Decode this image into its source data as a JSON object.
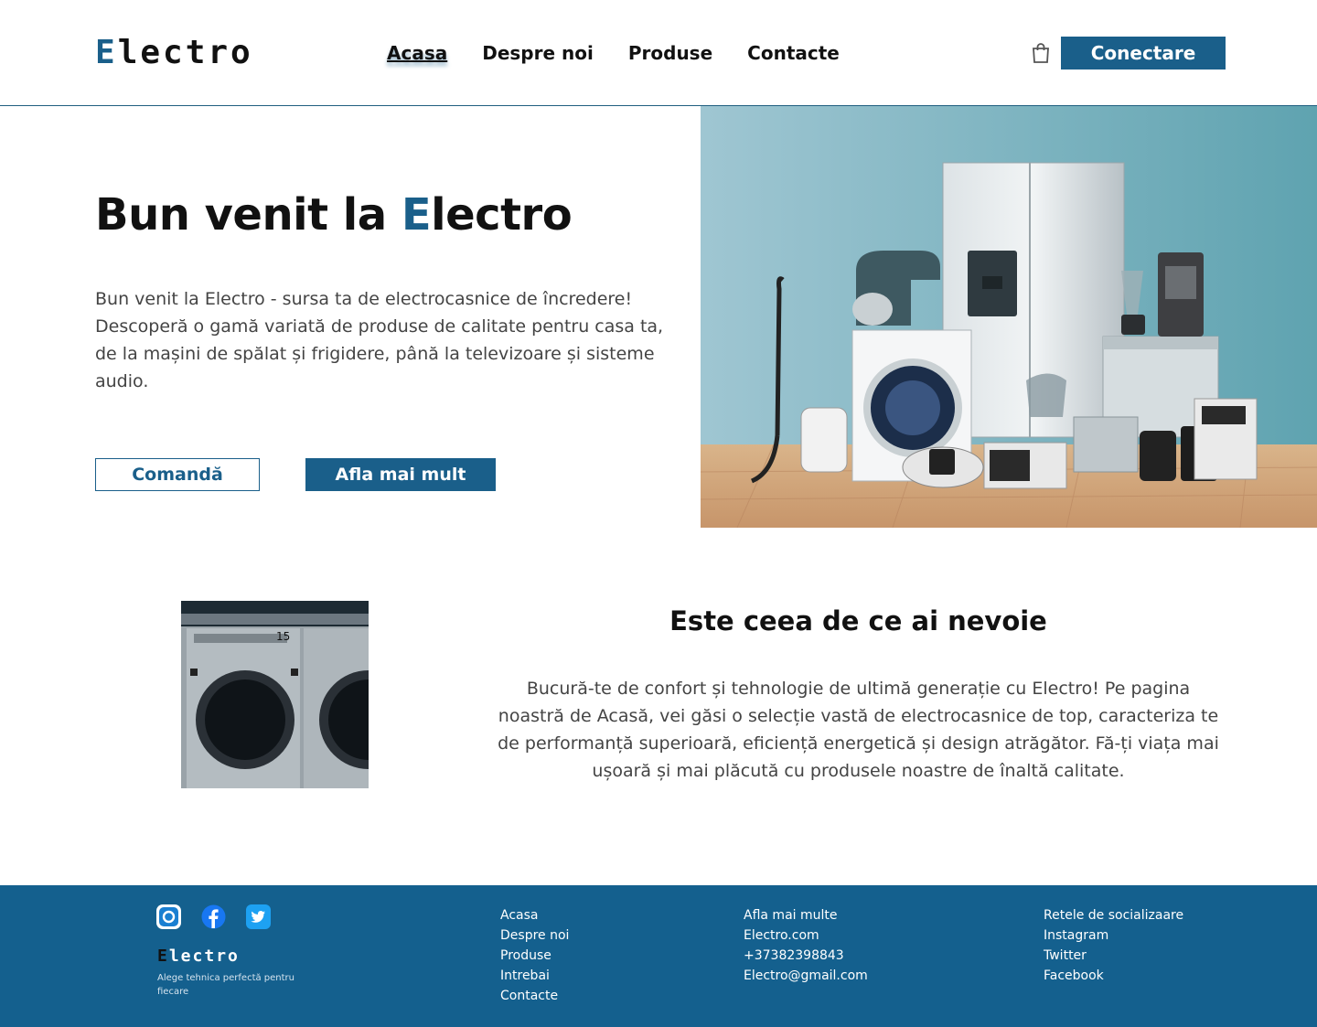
{
  "header": {
    "logo": {
      "first": "E",
      "rest": "lectro"
    },
    "nav": [
      {
        "label": "Acasa",
        "active": true
      },
      {
        "label": "Despre noi",
        "active": false
      },
      {
        "label": "Produse",
        "active": false
      },
      {
        "label": "Contacte",
        "active": false
      }
    ],
    "cart_icon": "shopping-bag-icon",
    "connect_label": "Conectare"
  },
  "hero": {
    "title_before": "Bun venit la ",
    "title_accent": "E",
    "title_after": "lectro",
    "text": "Bun venit la Electro - sursa ta de electrocasnice de încredere! Descoperă o gamă variată de produse de calitate pentru casa ta, de la mașini de spălat și frigidere, până la televizoare și sisteme audio.",
    "order_label": "Comandă",
    "more_label": "Afla mai mult"
  },
  "section": {
    "title": "Este ceea de ce ai nevoie",
    "text": "Bucură-te de confort și tehnologie de ultimă generație cu Electro! Pe pagina noastră de Acasă, vei găsi o selecție vastă de electrocasnice de top, caracteriza te de performanță superioară, eficiență energetică și design atrăgător. Fă-ți viața mai ușoară și mai plăcută cu produsele noastre de înaltă calitate."
  },
  "footer": {
    "social_icons": [
      "instagram-icon",
      "facebook-icon",
      "twitter-icon"
    ],
    "logo": {
      "first": "E",
      "rest": "lectro"
    },
    "tagline": "Alege tehnica perfectă pentru fiecare",
    "col1": [
      "Acasa",
      "Despre noi",
      "Produse",
      "Intrebai",
      "Contacte"
    ],
    "col2": [
      "Afla mai multe",
      "Electro.com",
      "+37382398843",
      "Electro@gmail.com"
    ],
    "col3": [
      "Retele de socializaare",
      "Instagram",
      "Twitter",
      "Facebook"
    ]
  },
  "colors": {
    "accent": "#1a5f8a",
    "footer_bg": "#14608e",
    "text": "#111111",
    "muted_text": "#444444"
  }
}
